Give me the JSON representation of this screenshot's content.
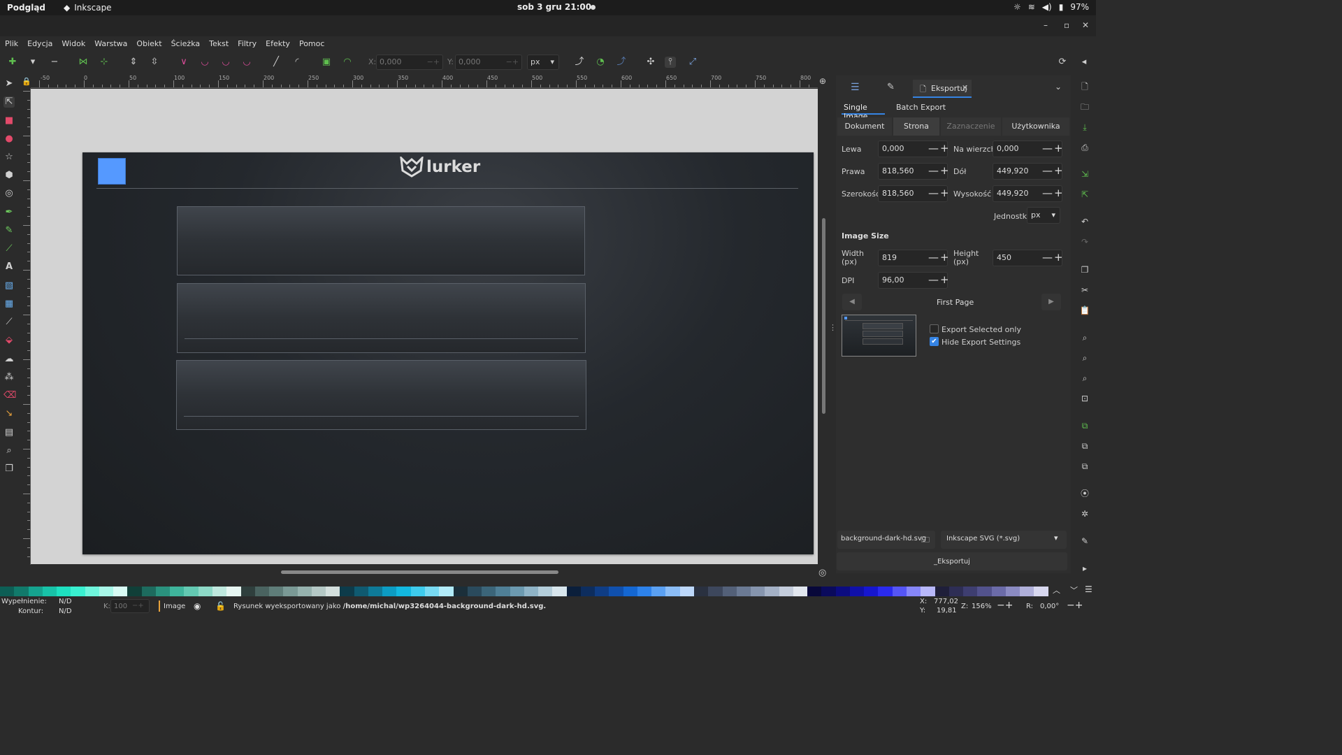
{
  "system_bar": {
    "app_name": "Podgląd",
    "active_app": "Inkscape",
    "clock": "sob 3 gru  21:00",
    "battery": "97%"
  },
  "menu": [
    "Plik",
    "Edycja",
    "Widok",
    "Warstwa",
    "Obiekt",
    "Ścieżka",
    "Tekst",
    "Filtry",
    "Efekty",
    "Pomoc"
  ],
  "toolbar": {
    "x_label": "X:",
    "x_value": "0,000",
    "y_label": "Y:",
    "y_value": "0,000",
    "unit": "px"
  },
  "ruler_labels": [
    "-50",
    "0",
    "50",
    "100",
    "150",
    "200",
    "250",
    "300",
    "350",
    "400",
    "450",
    "500",
    "550",
    "600",
    "650",
    "700",
    "750",
    "800"
  ],
  "canvas": {
    "logo_text": "lurker",
    "accent_color": "#5599ff"
  },
  "dock": {
    "export_tab_label": "Eksportuj",
    "mode_tabs": [
      "Single Image",
      "Batch Export"
    ],
    "area_tabs": [
      "Dokument",
      "Strona",
      "Zaznaczenie",
      "Użytkownika"
    ],
    "area": {
      "left_label": "Lewa",
      "left_value": "0,000",
      "top_label": "Na wierzch",
      "top_value": "0,000",
      "right_label": "Prawa",
      "right_value": "818,560",
      "bottom_label": "Dół",
      "bottom_value": "449,920",
      "width_label": "Szerokość",
      "width_value": "818,560",
      "height_label": "Wysokość",
      "height_value": "449,920",
      "units_label": "Jednostki",
      "units_value": "px"
    },
    "image_size": {
      "heading": "Image Size",
      "width_label": "Width (px)",
      "width_value": "819",
      "height_label": "Height (px)",
      "height_value": "450",
      "dpi_label": "DPI",
      "dpi_value": "96,00"
    },
    "page_nav_label": "First Page",
    "options": {
      "export_selected_only": "Export Selected only",
      "export_selected_only_checked": false,
      "hide_export_settings": "Hide Export Settings",
      "hide_export_settings_checked": true
    },
    "filename": "background-dark-hd.svg",
    "format": "Inkscape SVG (*.svg)",
    "export_button": "_Eksportuj"
  },
  "status": {
    "fill_label": "Wypełnienie:",
    "fill_value": "N/D",
    "stroke_label": "Kontur:",
    "stroke_value": "N/D",
    "opacity_label": "K:",
    "opacity_value": "100",
    "layer": "Image",
    "message_prefix": "Rysunek wyeksportowany jako ",
    "message_path": "/home/michal/wp3264044-background-dark-hd.svg.",
    "x_label": "X:",
    "x_value": "777,02",
    "y_label": "Y:",
    "y_value": "19,81",
    "zoom_label": "Z:",
    "zoom_value": "156%",
    "rotation_label": "R:",
    "rotation_value": "0,00°"
  },
  "palette": [
    "#0d5e55",
    "#117a6b",
    "#15a38f",
    "#18c2a8",
    "#1ee0c0",
    "#39f0d0",
    "#6ff5dc",
    "#a8f7e8",
    "#d8fbf4",
    "#103f38",
    "#1d6b5e",
    "#2a927e",
    "#3fb59c",
    "#63c9b2",
    "#8ed9c7",
    "#bfe8de",
    "#e6f5f1",
    "#2f3f3d",
    "#4a6360",
    "#5f7d79",
    "#7a9995",
    "#96b2ae",
    "#b4c8c5",
    "#d3dfdd",
    "#0d3b4a",
    "#0f5a70",
    "#0e7a98",
    "#0c9cc3",
    "#12b8e0",
    "#3ecbec",
    "#78daf2",
    "#b2ebf8",
    "#1b2f3a",
    "#2a4a5c",
    "#3b6579",
    "#4f7f96",
    "#6c9ab0",
    "#8fb4c7",
    "#b4cedb",
    "#d8e6ed",
    "#0b1f3b",
    "#0d2d5e",
    "#0f3d85",
    "#1050ad",
    "#1467d2",
    "#2d82ea",
    "#5aa0f2",
    "#8bbdf6",
    "#bdd8fa",
    "#2a3140",
    "#3d475c",
    "#536078",
    "#6b7a94",
    "#8695ae",
    "#a4b1c6",
    "#c4cddc",
    "#e2e7ef",
    "#08083a",
    "#0a0a5c",
    "#0c0c80",
    "#1010a8",
    "#1616cf",
    "#2a2aee",
    "#5555f5",
    "#8686f8",
    "#b8b8fb",
    "#1f1f3a",
    "#2e2e55",
    "#3e3e70",
    "#52528c",
    "#6b6ba8",
    "#8b8bc2",
    "#b0b0da",
    "#d8d8ef"
  ]
}
